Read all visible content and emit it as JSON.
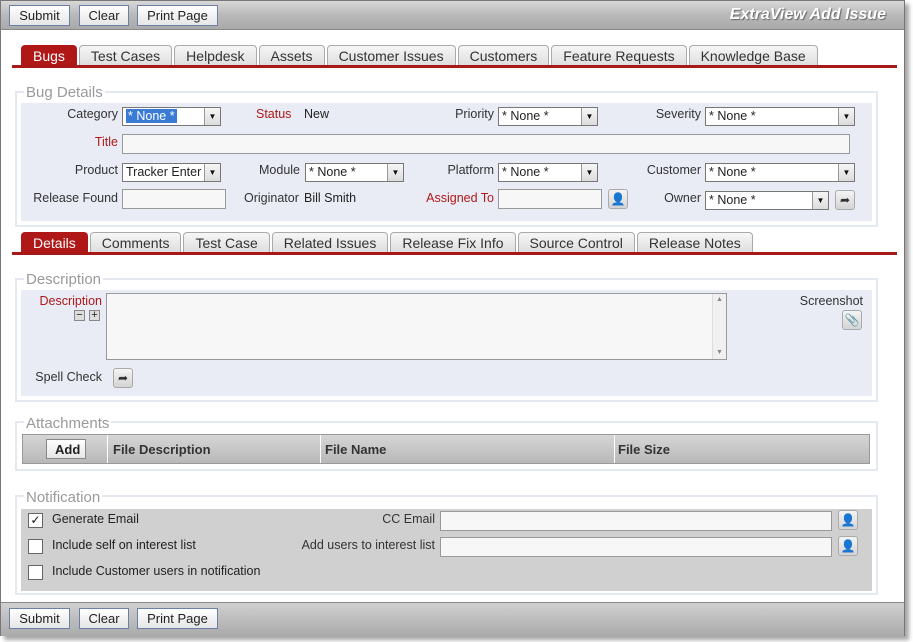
{
  "toolbar": {
    "submit": "Submit",
    "clear": "Clear",
    "print": "Print Page",
    "title": "ExtraView Add Issue"
  },
  "main_tabs": [
    "Bugs",
    "Test Cases",
    "Helpdesk",
    "Assets",
    "Customer Issues",
    "Customers",
    "Feature Requests",
    "Knowledge Base"
  ],
  "bug_details": {
    "legend": "Bug Details",
    "category_label": "Category",
    "category_value": "* None *",
    "status_label": "Status",
    "status_value": "New",
    "priority_label": "Priority",
    "priority_value": "* None *",
    "severity_label": "Severity",
    "severity_value": "* None *",
    "title_label": "Title",
    "title_value": "",
    "product_label": "Product",
    "product_value": "Tracker Enter",
    "module_label": "Module",
    "module_value": "* None *",
    "platform_label": "Platform",
    "platform_value": "* None *",
    "customer_label": "Customer",
    "customer_value": "* None *",
    "release_found_label": "Release Found",
    "release_found_value": "",
    "originator_label": "Originator",
    "originator_value": "Bill Smith",
    "assigned_to_label": "Assigned To",
    "assigned_to_value": "",
    "owner_label": "Owner",
    "owner_value": "* None *"
  },
  "detail_tabs": [
    "Details",
    "Comments",
    "Test Case",
    "Related Issues",
    "Release Fix Info",
    "Source Control",
    "Release Notes"
  ],
  "description": {
    "legend": "Description",
    "label": "Description",
    "value": "",
    "screenshot_label": "Screenshot",
    "spell_check_label": "Spell Check"
  },
  "attachments": {
    "legend": "Attachments",
    "add": "Add",
    "columns": [
      "File Description",
      "File Name",
      "File Size"
    ]
  },
  "notification": {
    "legend": "Notification",
    "generate_email": {
      "label": "Generate Email",
      "checked": true
    },
    "include_self": {
      "label": "Include self on interest list",
      "checked": false
    },
    "include_customer": {
      "label": "Include Customer users in notification",
      "checked": false
    },
    "cc_email_label": "CC Email",
    "cc_email_value": "",
    "add_users_label": "Add users to interest list",
    "add_users_value": ""
  },
  "colors": {
    "accent": "#b01818",
    "panel": "#e9ecf5",
    "toolbar": "#b9b9b9"
  },
  "icons": {
    "user_lookup": "user-icon",
    "arrow": "forward-arrow-icon",
    "attach": "paperclip-icon",
    "expand": "plus-icon",
    "collapse": "minus-icon",
    "checkmark": "check-icon"
  }
}
